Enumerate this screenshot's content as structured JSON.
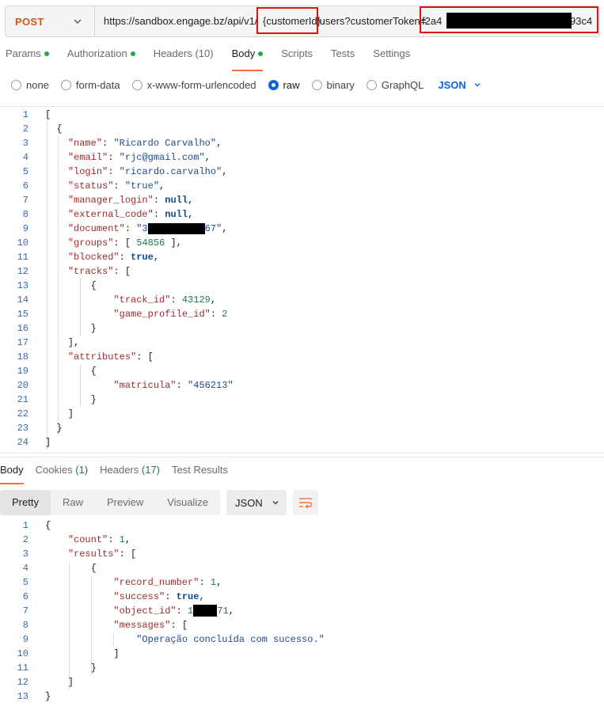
{
  "request": {
    "method": "POST",
    "url_parts": {
      "prefix": "https://sandbox.engage.bz/api/v1/",
      "path_param": "{customerId}",
      "middle": "/users?customerToken=",
      "token_start": "f2a4",
      "token_end": "93c4"
    }
  },
  "req_tabs": [
    {
      "label": "Params",
      "dot": true
    },
    {
      "label": "Authorization",
      "dot": true
    },
    {
      "label": "Headers",
      "count": "(10)"
    },
    {
      "label": "Body",
      "dot": true,
      "active": true
    },
    {
      "label": "Scripts"
    },
    {
      "label": "Tests"
    },
    {
      "label": "Settings"
    }
  ],
  "body_types": [
    "none",
    "form-data",
    "x-www-form-urlencoded",
    "raw",
    "binary",
    "GraphQL"
  ],
  "body_type_selected": "raw",
  "body_language": "JSON",
  "request_body": {
    "line_numbers": [
      "1",
      "2",
      "3",
      "4",
      "5",
      "6",
      "7",
      "8",
      "9",
      "10",
      "11",
      "12",
      "13",
      "14",
      "15",
      "16",
      "17",
      "18",
      "19",
      "20",
      "21",
      "22",
      "23",
      "24"
    ],
    "user": {
      "name": "\"Ricardo Carvalho\"",
      "email": "\"rjc@gmail.com\"",
      "login": "\"ricardo.carvalho\"",
      "status": "\"true\"",
      "manager_login": "null",
      "external_code": "null",
      "document_start": "\"3",
      "document_end": "67\"",
      "group": "54856",
      "blocked": "true",
      "track_id": "43129",
      "game_profile_id": "2",
      "matricula": "\"456213\""
    }
  },
  "resp_tabs": [
    {
      "label": "Body",
      "active": true
    },
    {
      "label": "Cookies",
      "count": "(1)"
    },
    {
      "label": "Headers",
      "count": "(17)"
    },
    {
      "label": "Test Results"
    }
  ],
  "view_modes": [
    "Pretty",
    "Raw",
    "Preview",
    "Visualize"
  ],
  "view_selected": "Pretty",
  "response_format": "JSON",
  "response_body": {
    "line_numbers": [
      "1",
      "2",
      "3",
      "4",
      "5",
      "6",
      "7",
      "8",
      "9",
      "10",
      "11",
      "12",
      "13"
    ],
    "count": "1",
    "record_number": "1",
    "success": "true",
    "object_id_start": "1",
    "object_id_end": "71",
    "message": "\"Operação concluída com sucesso.\""
  },
  "colors": {
    "method": "#d1541e",
    "accent": "#ff6c37",
    "radio_selected": "#0a64d8",
    "annotation": "#e01010",
    "tab_dot": "#28a745"
  }
}
